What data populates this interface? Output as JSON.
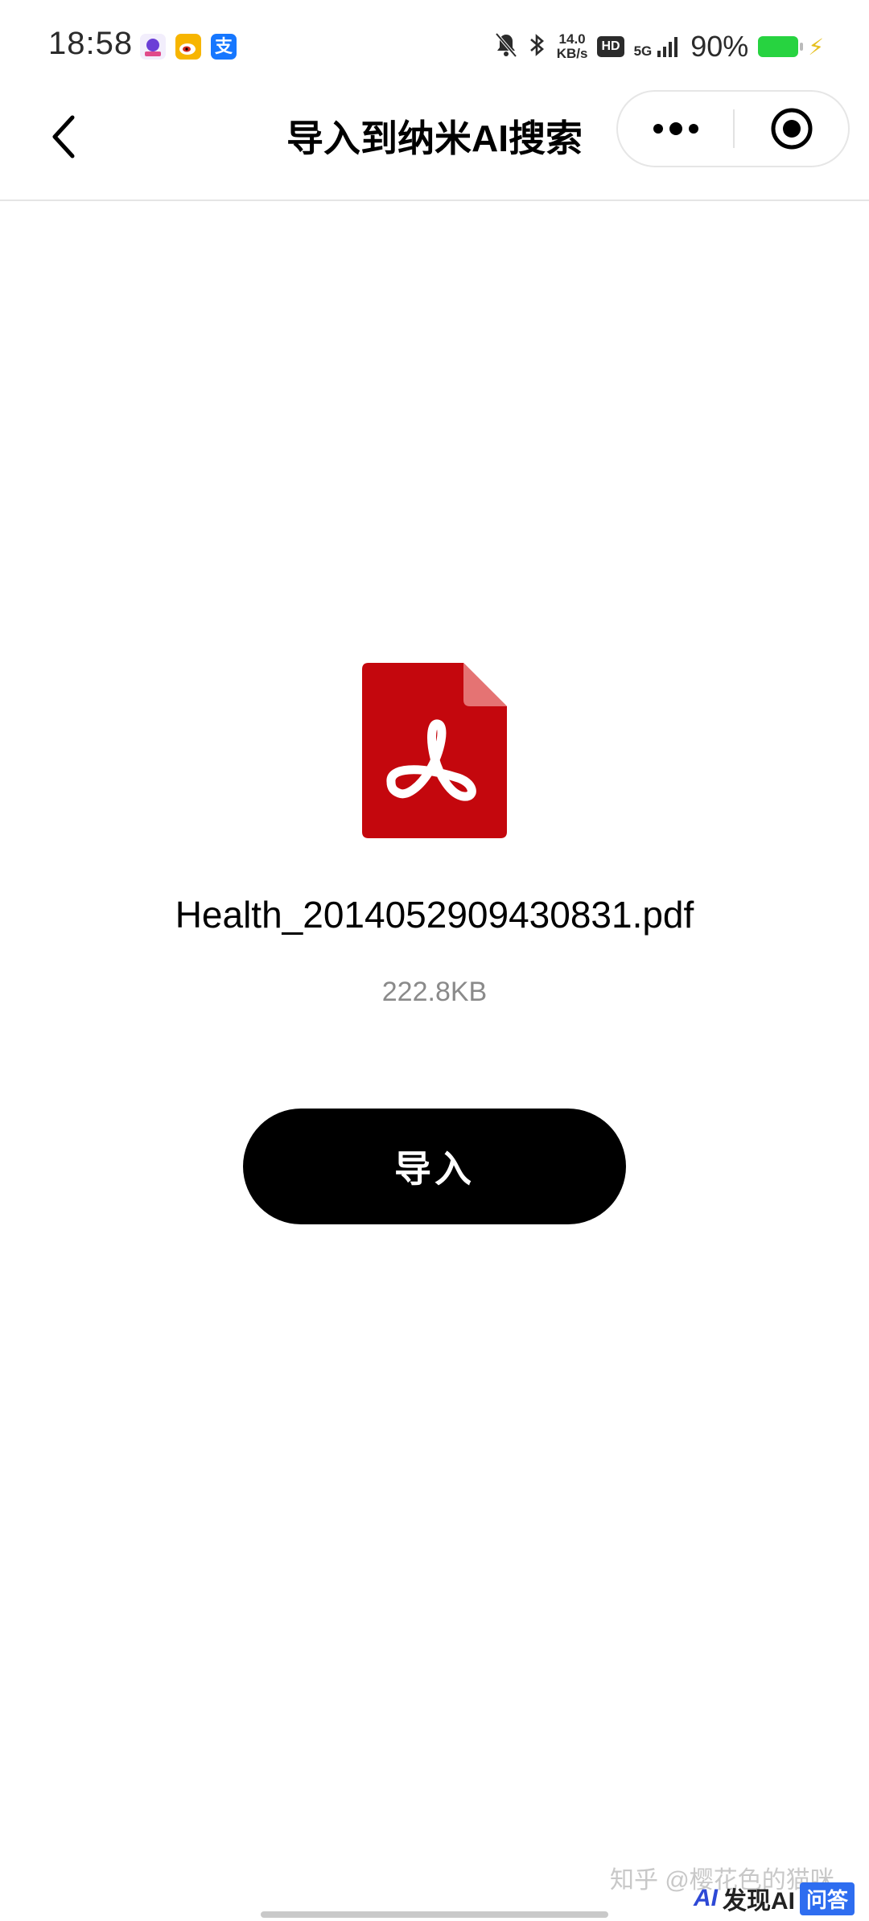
{
  "status_bar": {
    "time": "18:58",
    "app3_glyph": "支",
    "net_speed_value": "14.0",
    "net_speed_unit": "KB/s",
    "hd_label": "HD",
    "network_label": "5G",
    "battery_text": "90%",
    "icons": [
      "app-icon",
      "weibo-icon",
      "alipay-icon",
      "mute-icon",
      "bluetooth-icon",
      "signal-icon",
      "battery-icon",
      "charging-icon"
    ]
  },
  "navbar": {
    "title": "导入到纳米AI搜索",
    "icons": [
      "back-icon",
      "more-icon",
      "close-target-icon"
    ]
  },
  "file": {
    "icon": "pdf-icon",
    "name": "Health_2014052909430831.pdf",
    "size": "222.8KB",
    "colors": {
      "icon_red": "#c4070d",
      "icon_fold": "#e57373"
    }
  },
  "import_button": {
    "label": "导入"
  },
  "watermark": {
    "zhihu_text": "知乎 @樱花色的猫咪",
    "badge_ai": "AI",
    "badge_brand": "发现AI",
    "badge_qa": "问答"
  }
}
